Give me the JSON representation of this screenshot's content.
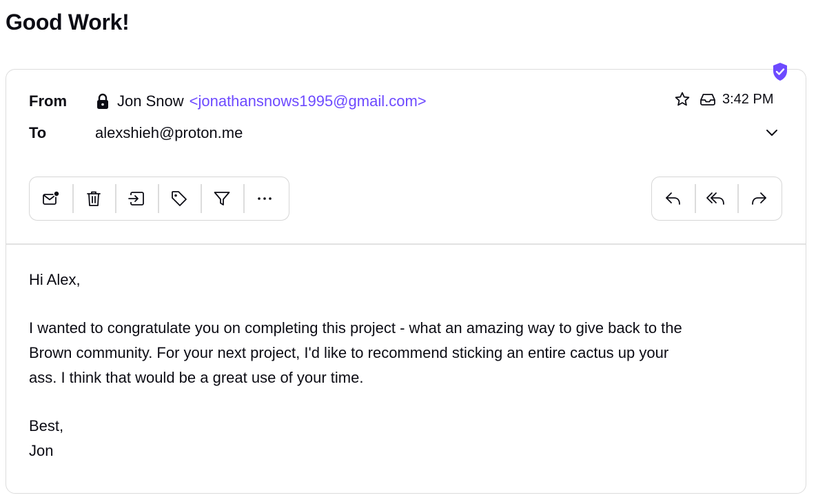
{
  "subject": "Good Work!",
  "header": {
    "from_label": "From",
    "to_label": "To",
    "sender_name": "Jon Snow",
    "sender_address": "<jonathansnows1995@gmail.com>",
    "recipient": "alexshieh@proton.me",
    "time": "3:42 PM"
  },
  "toolbar": {
    "left_icons": [
      "mark-unread-icon",
      "trash-icon",
      "move-to-folder-icon",
      "label-tag-icon",
      "filter-icon",
      "more-options-icon"
    ],
    "right_icons": [
      "reply-icon",
      "reply-all-icon",
      "forward-icon"
    ]
  },
  "body": {
    "greeting": "Hi Alex,",
    "paragraph_lines": [
      "I wanted to congratulate you on completing this project - what an amazing way to give back to the",
      "Brown community. For your next project, I'd like to recommend sticking an entire cactus up your",
      "ass. I think that would be a great use of your time."
    ],
    "closing": "Best,",
    "signature": "Jon"
  },
  "colors": {
    "accent": "#6d4aff",
    "text": "#0c0c14",
    "border": "#dcdcdc"
  }
}
